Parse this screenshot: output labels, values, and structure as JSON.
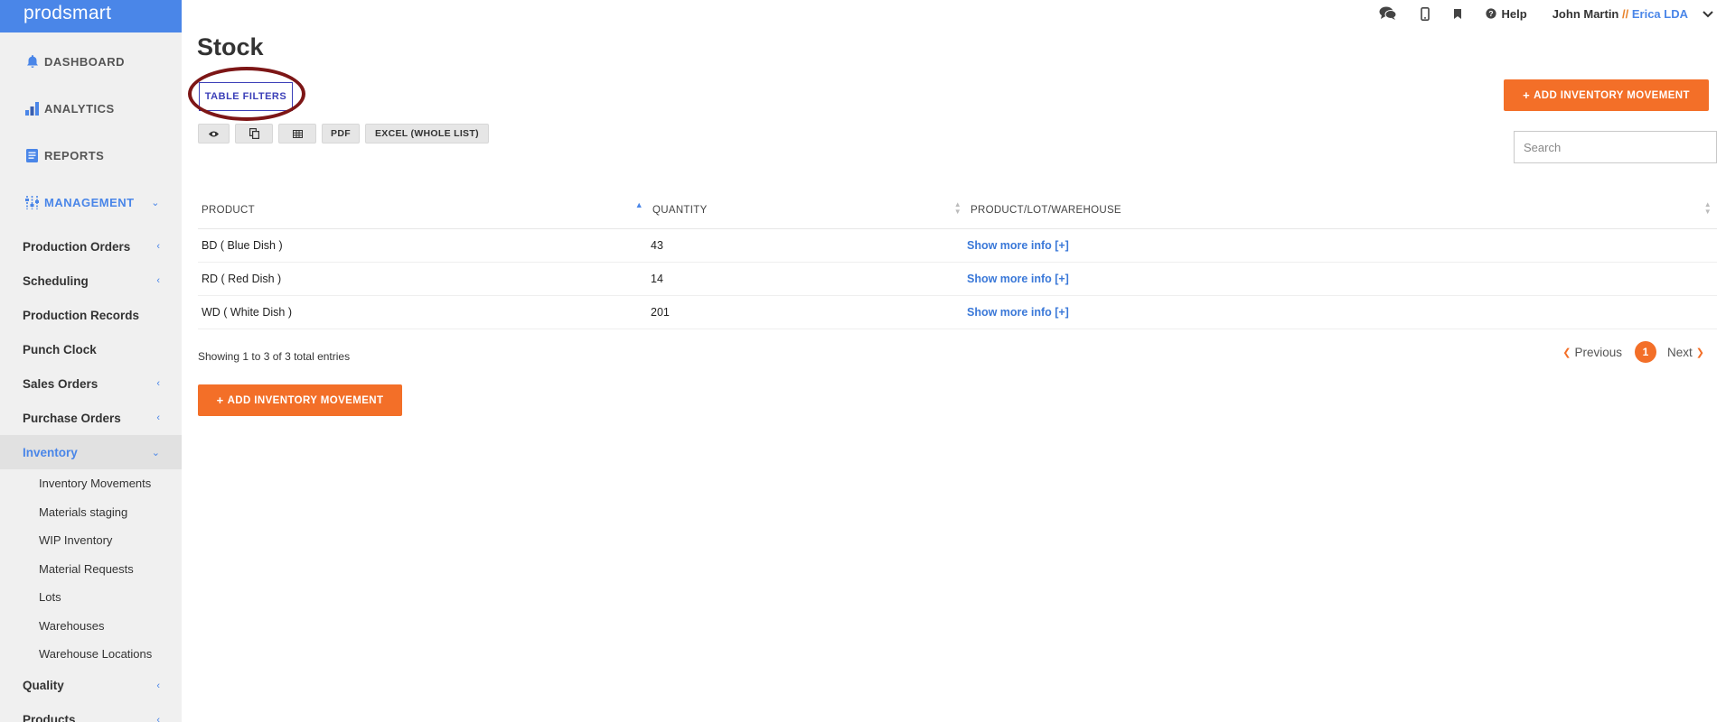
{
  "app": {
    "logo": "prodsmart"
  },
  "sidebar": {
    "top_items": [
      {
        "label": "DASHBOARD",
        "icon": "bell-icon"
      },
      {
        "label": "ANALYTICS",
        "icon": "bar-chart-icon"
      },
      {
        "label": "REPORTS",
        "icon": "document-icon"
      },
      {
        "label": "MANAGEMENT",
        "icon": "sliders-icon"
      }
    ],
    "items": [
      {
        "label": "Production Orders"
      },
      {
        "label": "Scheduling"
      },
      {
        "label": "Production Records"
      },
      {
        "label": "Punch Clock"
      },
      {
        "label": "Sales Orders"
      },
      {
        "label": "Purchase Orders"
      },
      {
        "label": "Inventory"
      },
      {
        "label": "Quality"
      },
      {
        "label": "Products"
      }
    ],
    "inventory_sub": [
      "Inventory Movements",
      "Materials staging",
      "WIP Inventory",
      "Material Requests",
      "Lots",
      "Warehouses",
      "Warehouse Locations"
    ]
  },
  "header": {
    "help": "Help",
    "user_name": "John Martin",
    "separator": " //",
    "company": "Erica LDA"
  },
  "page": {
    "title": "Stock",
    "table_filters": "TABLE FILTERS",
    "add_movement": "ADD INVENTORY MOVEMENT",
    "tools": {
      "pdf": "PDF",
      "excel": "EXCEL (WHOLE LIST)"
    },
    "search_placeholder": "Search",
    "showing": "Showing 1 to 3 of 3 total entries"
  },
  "table": {
    "columns": [
      "PRODUCT",
      "QUANTITY",
      "PRODUCT/LOT/WAREHOUSE"
    ],
    "rows": [
      {
        "product": "BD ( Blue Dish )",
        "quantity": "43",
        "info": "Show more info [+]"
      },
      {
        "product": "RD ( Red Dish )",
        "quantity": "14",
        "info": "Show more info [+]"
      },
      {
        "product": "WD ( White Dish )",
        "quantity": "201",
        "info": "Show more info [+]"
      }
    ]
  },
  "pagination": {
    "previous": "Previous",
    "current": "1",
    "next": "Next"
  },
  "colors": {
    "accent": "#4a86e8",
    "orange": "#f36f28",
    "annotation": "#7d1616"
  }
}
